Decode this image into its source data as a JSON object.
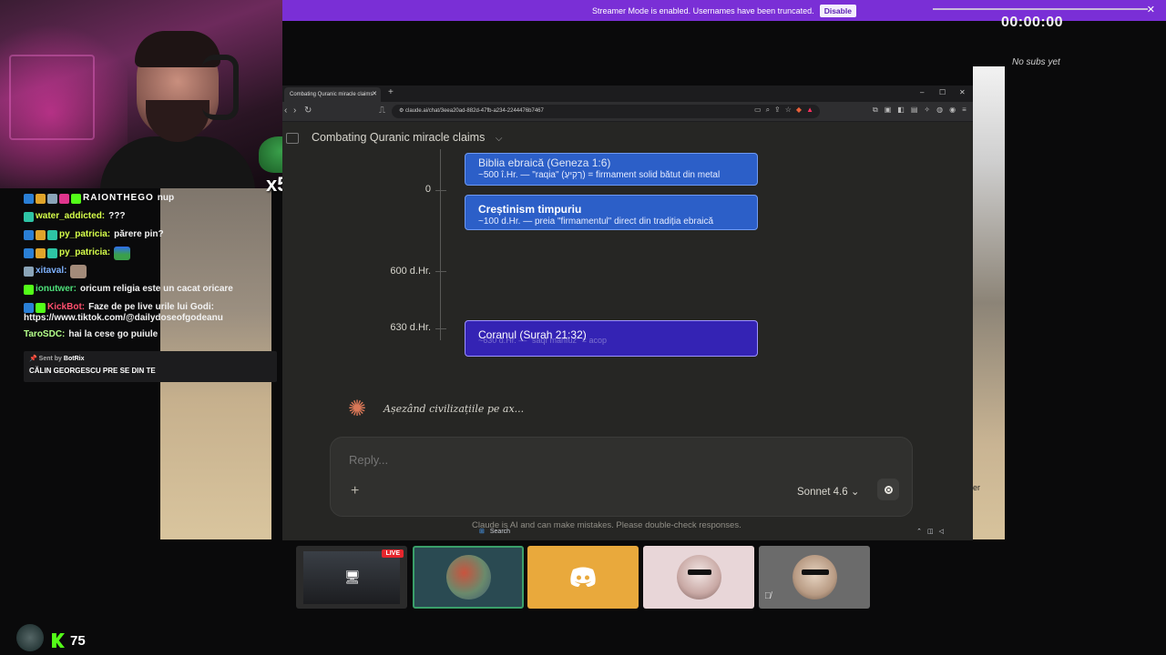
{
  "banner": {
    "text": "Streamer Mode is enabled. Usernames have been truncated.",
    "button": "Disable",
    "close": "✕"
  },
  "timer": "00:00:00",
  "subs_text": "No subs yet",
  "emote_counter": "x5",
  "chat": [
    {
      "user": "RAIONTHEGO",
      "msg": "nup",
      "color": "#ffffff"
    },
    {
      "user": "water_addicted:",
      "msg": "???",
      "color": "#d6ff4a"
    },
    {
      "user": "py_patricia:",
      "msg": "părere pin?",
      "color": "#d6ff4a"
    },
    {
      "user": "py_patricia:",
      "msg": "",
      "color": "#d6ff4a"
    },
    {
      "user": "xitaval:",
      "msg": "",
      "color": "#7fb3ff"
    },
    {
      "user": "ionutwer:",
      "msg": "oricum religia este un cacat oricare",
      "color": "#4ee07a"
    },
    {
      "user": "KickBot:",
      "msg": "Faze de pe live urile lui Godi:",
      "color": "#ff4f6d"
    },
    {
      "user": "",
      "msg": "https://www.tiktok.com/@dailydoseofgodeanu",
      "color": "#ffffff"
    },
    {
      "user": "TaroSDC:",
      "msg": "hai la cese go puiule",
      "color": "#b4ff8a"
    }
  ],
  "sent_box": {
    "label": "Sent by",
    "user": "BotRix",
    "msg": "CĂLIN GEORGESCU PRE SE DIN TE"
  },
  "browser": {
    "tab_title": "Combating Quranic miracle claims",
    "tab_close": "✕",
    "new_tab": "+",
    "url": "claude.ai/chat/3eea20ad-882d-47fb-a234-2244476b7467",
    "conversation_title": "Combating Quranic miracle claims",
    "window_controls": [
      "–",
      "☐",
      "✕"
    ]
  },
  "timeline": {
    "labels": [
      "0",
      "600 d.Hr.",
      "630 d.Hr."
    ],
    "cards": [
      {
        "title": "Biblia ebraică (Geneza 1:6)",
        "sub": "~500 î.Hr. — \"raqia\" (רָקִיעַ) = firmament solid bătut din metal"
      },
      {
        "title": "Creștinism timpuriu",
        "sub": "~100 d.Hr. — preia \"firmamentul\" direct din tradiția ebraică"
      },
      {
        "title": "Coranul (Surah 21:32)",
        "sub": "~630 d.Hr. — \"saqf mahfuz\" = acop"
      }
    ]
  },
  "status_text": "Așezând civilizațiile pe ax...",
  "reply": {
    "placeholder": "Reply...",
    "model": "Sonnet 4.6 ⌄",
    "plus": "+"
  },
  "disclaimer": "Claude is AI and can make mistakes. Please double-check responses.",
  "taskbar_search": "Search",
  "game_overlay_text": "er",
  "tiles": [
    {
      "name": "screen-share",
      "bg": "#2b2b2b",
      "live": "LIVE"
    },
    {
      "name": "user-2",
      "bg": "#2a4a52"
    },
    {
      "name": "discord",
      "bg": "#e9a93c"
    },
    {
      "name": "user-4",
      "bg": "#e8d6d8"
    },
    {
      "name": "user-5",
      "bg": "#6b6b6b"
    }
  ],
  "viewer_count": "75",
  "colors": {
    "accent_purple": "#7a2fd6",
    "kick_green": "#53fc18",
    "card_blue": "#2c5fc8",
    "card_purple": "#3423b4",
    "claude_orange": "#d97757"
  }
}
